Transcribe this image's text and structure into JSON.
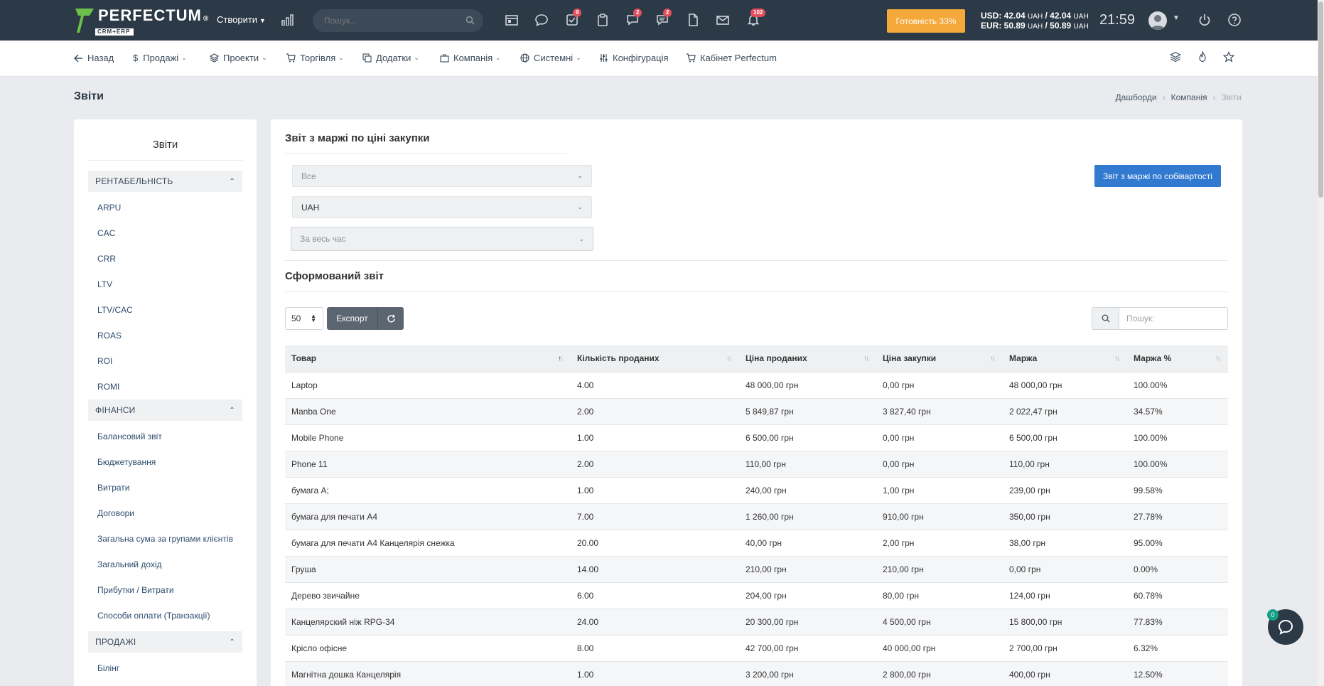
{
  "topbar": {
    "logo_text": "PERFECTUM",
    "logo_sub": "CRM+ERP",
    "logo_reg": "®",
    "create_label": "Створити",
    "search_placeholder": "Пошук...",
    "badges": {
      "tasks": "9",
      "chat": "2",
      "messages": "2",
      "bell": "102"
    },
    "ready_label": "Готовність 33%",
    "rates": {
      "usd_label": "USD: 42.04",
      "usd_unit1": "UAH",
      "usd_mid": " / 42.04",
      "usd_unit2": "UAH",
      "eur_label": "EUR: 50.89",
      "eur_unit1": "UAH",
      "eur_mid": " / 50.89",
      "eur_unit2": "UAH"
    },
    "clock": "21:59"
  },
  "nav": {
    "back": "Назад",
    "sales": "Продажі",
    "projects": "Проекти",
    "trade": "Торгівля",
    "addons": "Додатки",
    "company": "Компанія",
    "system": "Системні",
    "config": "Конфігурація",
    "cabinet": "Кабінет Perfectum"
  },
  "page": {
    "title": "Звіти",
    "breadcrumb": [
      "Дашборди",
      "Компанія",
      "Звіти"
    ]
  },
  "sidebar": {
    "title": "Звіти",
    "sections": [
      {
        "label": "РЕНТАБЕЛЬНІСТЬ",
        "items": [
          "ARPU",
          "CAC",
          "CRR",
          "LTV",
          "LTV/CAC",
          "ROAS",
          "ROI",
          "ROMI"
        ]
      },
      {
        "label": "ФІНАНСИ",
        "items": [
          "Балансовий звіт",
          "Бюджетування",
          "Витрати",
          "Договори",
          "Загальна сума за групами клієнтів",
          "Загальний дохід",
          "Прибутки / Витрати",
          "Способи оплати (Транзакції)"
        ]
      },
      {
        "label": "ПРОДАЖІ",
        "items": [
          "Білінг"
        ]
      }
    ]
  },
  "main": {
    "title": "Звіт з маржі по ціні закупки",
    "filter_all": "Все",
    "filter_currency": "UAH",
    "filter_period": "За весь час",
    "margin_cost_button": "Звіт з маржі по собівартості",
    "subtitle": "Сформований звіт",
    "page_size": "50",
    "export_label": "Експорт",
    "search_placeholder": "Пошук:"
  },
  "table": {
    "headers": [
      "Товар",
      "Кількість проданих",
      "Ціна проданих",
      "Ціна закупки",
      "Маржа",
      "Маржа %"
    ],
    "rows": [
      [
        "Laptop",
        "4.00",
        "48 000,00 грн",
        "0,00 грн",
        "48 000,00 грн",
        "100.00%"
      ],
      [
        "Manba One",
        "2.00",
        "5 849,87 грн",
        "3 827,40 грн",
        "2 022,47 грн",
        "34.57%"
      ],
      [
        "Mobile Phone",
        "1.00",
        "6 500,00 грн",
        "0,00 грн",
        "6 500,00 грн",
        "100.00%"
      ],
      [
        "Phone 11",
        "2.00",
        "110,00 грн",
        "0,00 грн",
        "110,00 грн",
        "100.00%"
      ],
      [
        "бумага А;",
        "1.00",
        "240,00 грн",
        "1,00 грн",
        "239,00 грн",
        "99.58%"
      ],
      [
        "бумага для печати А4",
        "7.00",
        "1 260,00 грн",
        "910,00 грн",
        "350,00 грн",
        "27.78%"
      ],
      [
        "бумага для печати А4 Канцелярія снежка",
        "20.00",
        "40,00 грн",
        "2,00 грн",
        "38,00 грн",
        "95.00%"
      ],
      [
        "Груша",
        "14.00",
        "210,00 грн",
        "210,00 грн",
        "0,00 грн",
        "0.00%"
      ],
      [
        "Дерево звичайне",
        "6.00",
        "204,00 грн",
        "80,00 грн",
        "124,00 грн",
        "60.78%"
      ],
      [
        "Канцелярский ніж RPG-34",
        "24.00",
        "20 300,00 грн",
        "4 500,00 грн",
        "15 800,00 грн",
        "77.83%"
      ],
      [
        "Крісло офісне",
        "8.00",
        "42 700,00 грн",
        "40 000,00 грн",
        "2 700,00 грн",
        "6.32%"
      ],
      [
        "Магнітна дошка Канцелярія",
        "1.00",
        "3 200,00 грн",
        "2 800,00 грн",
        "400,00 грн",
        "12.50%"
      ]
    ]
  },
  "chat": {
    "badge": "0"
  },
  "colors": {
    "topbar": "#2c3946",
    "accent": "#3279d0",
    "ready": "#f4a93a",
    "badge": "#e24e5e"
  }
}
